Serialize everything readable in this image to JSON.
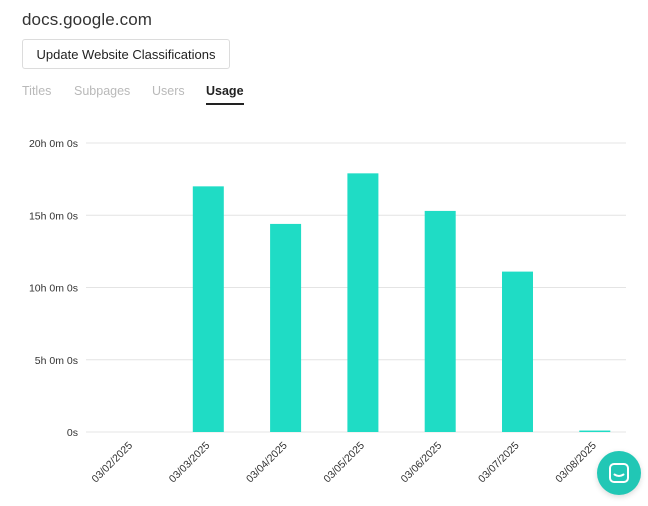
{
  "header": {
    "site": "docs.google.com",
    "update_button": "Update Website Classifications"
  },
  "tabs": [
    {
      "label": "Titles",
      "active": false
    },
    {
      "label": "Subpages",
      "active": false
    },
    {
      "label": "Users",
      "active": false
    },
    {
      "label": "Usage",
      "active": true
    }
  ],
  "chart_data": {
    "type": "bar",
    "categories": [
      "03/02/2025",
      "03/03/2025",
      "03/04/2025",
      "03/05/2025",
      "03/06/2025",
      "03/07/2025",
      "03/08/2025"
    ],
    "values_hours": [
      0,
      17,
      14.4,
      17.9,
      15.3,
      11.1,
      0.1
    ],
    "yticks": [
      "0s",
      "5h 0m 0s",
      "10h 0m 0s",
      "15h 0m 0s",
      "20h 0m 0s"
    ],
    "ylim_hours": [
      0,
      20
    ],
    "bar_color": "#1fdcc5",
    "grid": true
  },
  "chat": {
    "icon": "chat-icon",
    "color": "#21c7b5"
  }
}
